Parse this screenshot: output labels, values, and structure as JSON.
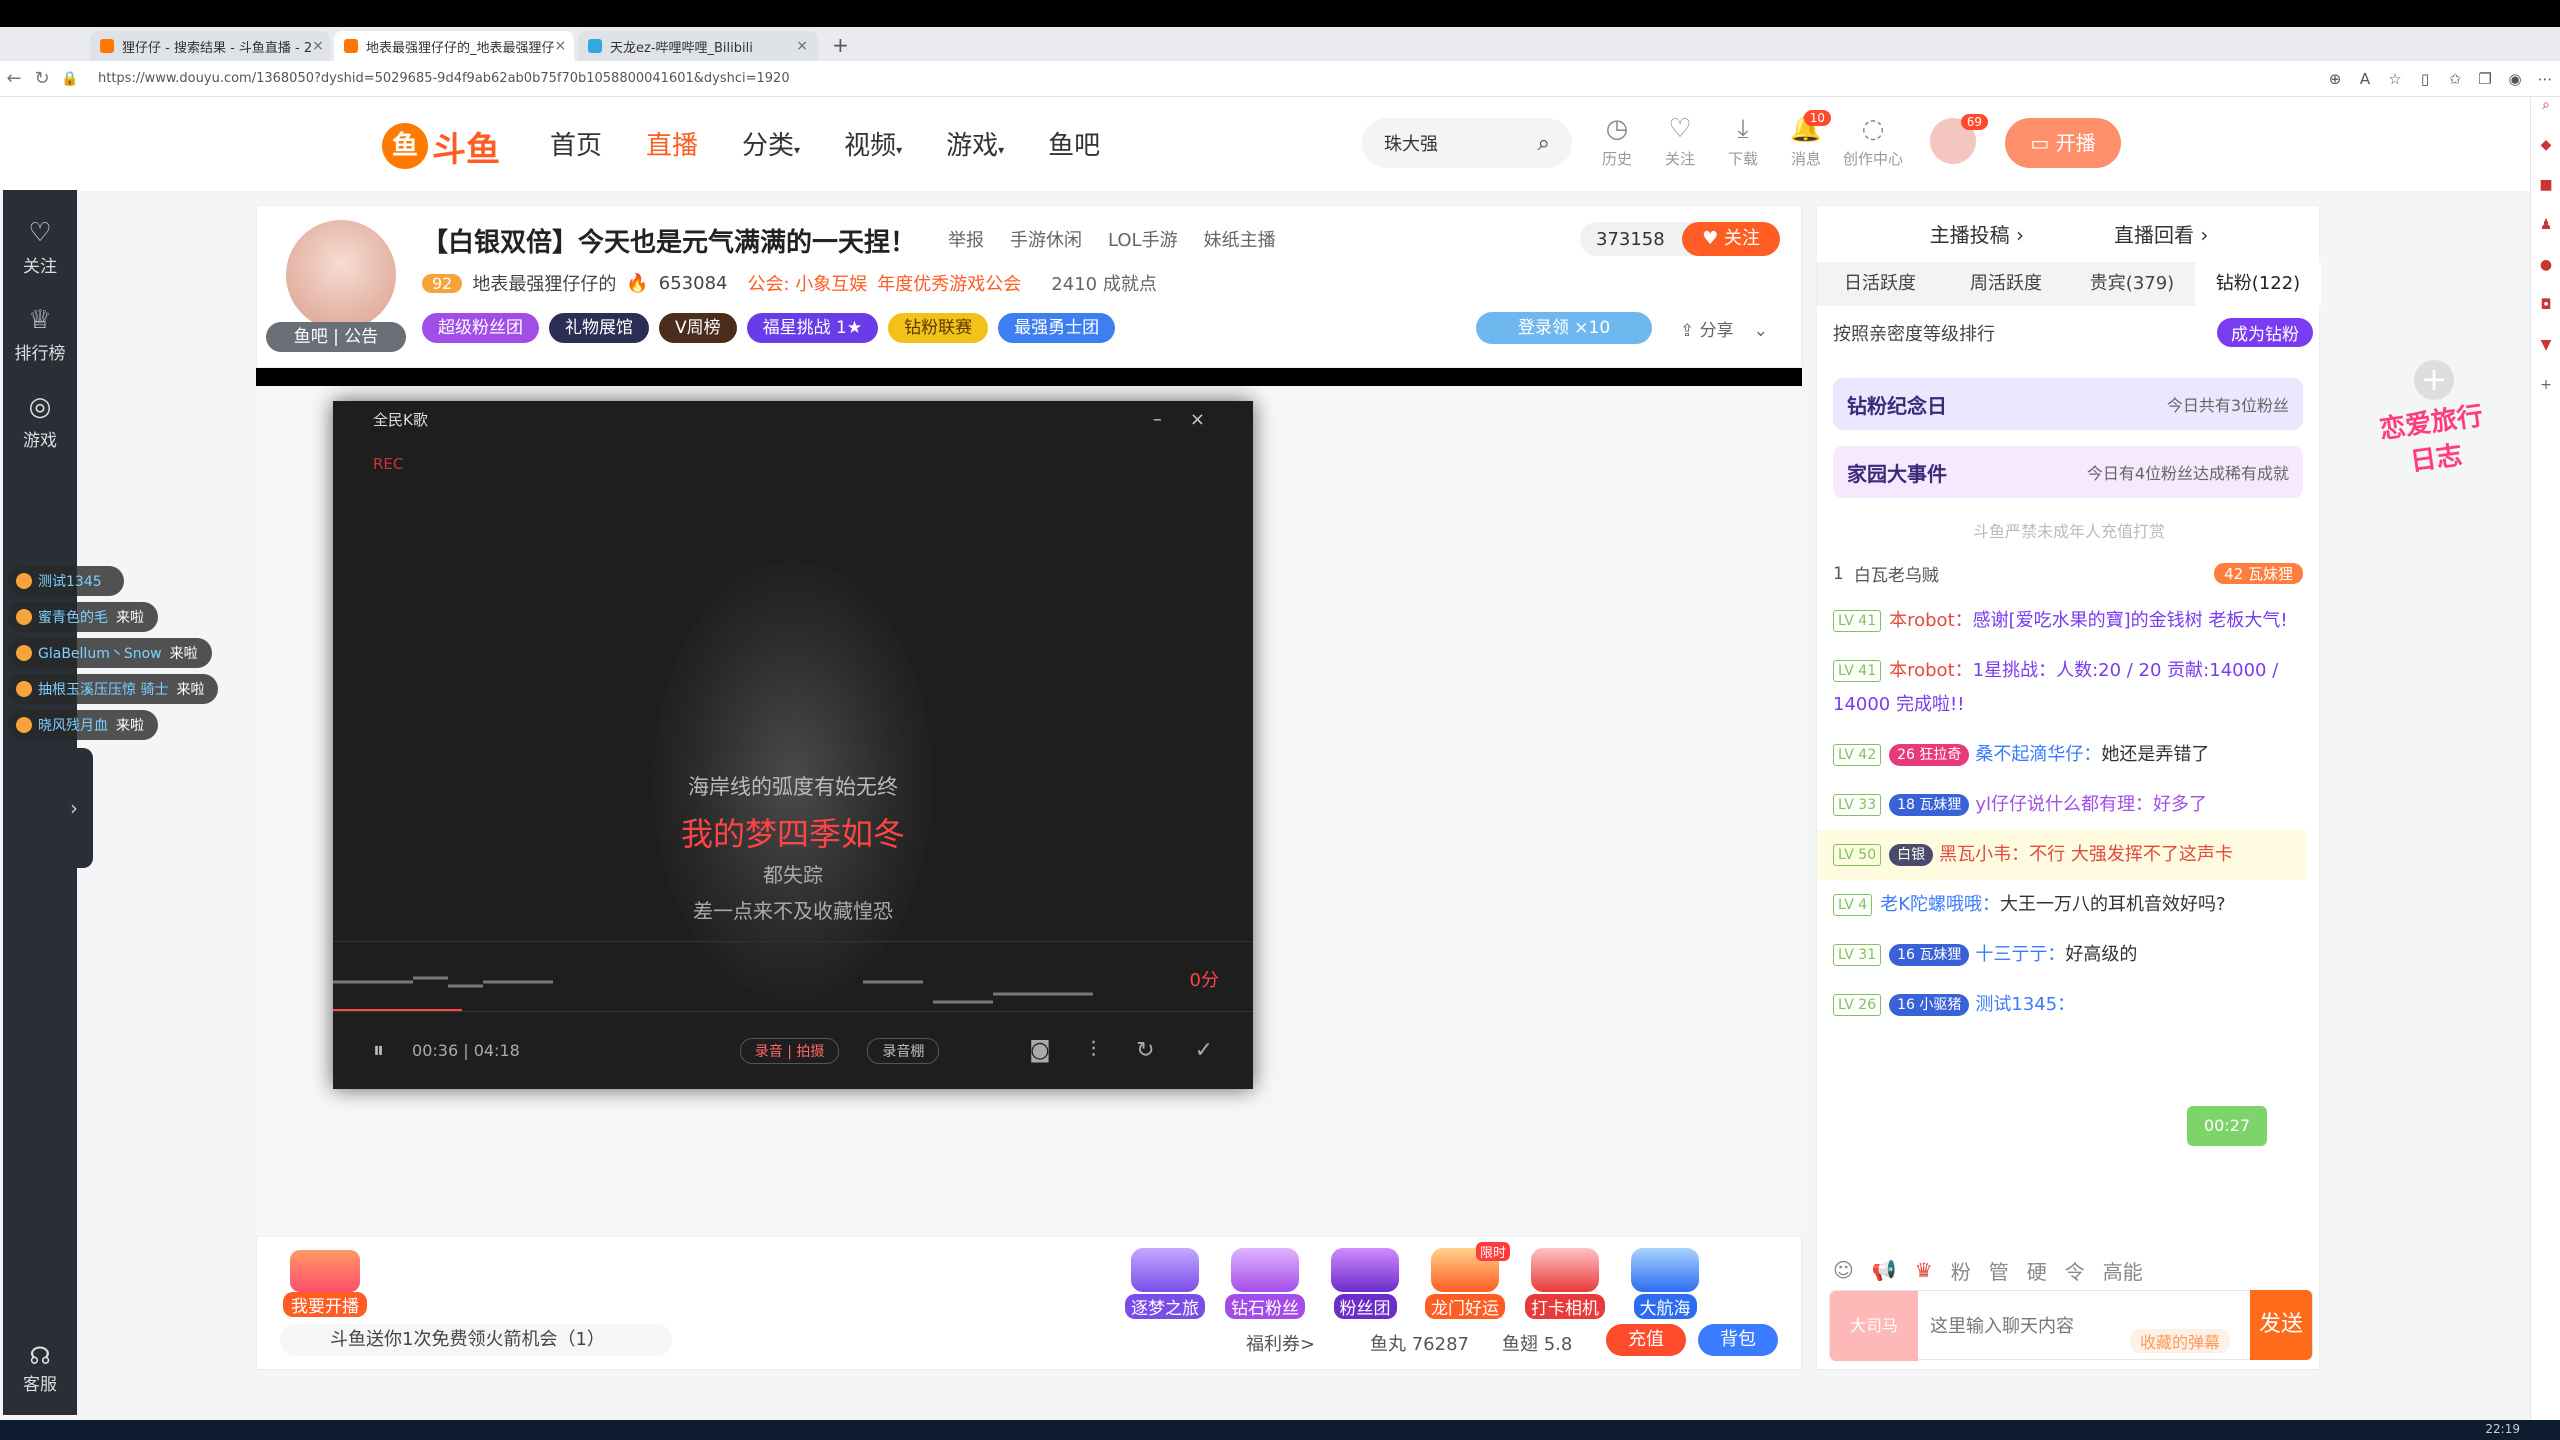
{
  "browser": {
    "tabs": [
      {
        "title": "狸仔仔 - 搜索结果 - 斗鱼直播 - 2"
      },
      {
        "title": "地表最强狸仔仔的_地表最强狸仔"
      },
      {
        "title": "天龙ez-哔哩哔哩_Bilibili"
      }
    ],
    "new_tab": "+",
    "url": "https://www.douyu.com/1368050?dyshid=5029685-9d4f9ab62ab0b75f70b1058800041601&dyshci=1920"
  },
  "site": {
    "logo_text": "斗鱼",
    "nav": [
      "首页",
      "直播",
      "分类",
      "视频",
      "游戏",
      "鱼吧"
    ],
    "search_value": "珠大强",
    "header_icons": [
      {
        "label": "历史",
        "icon": "clock-icon"
      },
      {
        "label": "关注",
        "icon": "heart-icon"
      },
      {
        "label": "下载",
        "icon": "download-icon"
      },
      {
        "label": "消息",
        "icon": "bell-icon",
        "badge": "10"
      },
      {
        "label": "创作中心",
        "icon": "lightbulb-icon"
      }
    ],
    "avatar_badge": "69",
    "live_button": "开播"
  },
  "left_sidebar": {
    "items": [
      {
        "label": "关注",
        "icon": "heart-outline-icon"
      },
      {
        "label": "排行榜",
        "icon": "ranking-icon"
      },
      {
        "label": "游戏",
        "icon": "game-icon"
      }
    ],
    "footer": "客服",
    "expand": "›"
  },
  "welcomes": [
    {
      "name": "测试1345",
      "suffix": ""
    },
    {
      "name": "蜜青色的毛",
      "suffix": "来啦"
    },
    {
      "name": "GlaBellum丶Snow",
      "suffix": "来啦"
    },
    {
      "name": "抽根玉溪压压惊 骑士",
      "suffix": "来啦"
    },
    {
      "name": "晓风残月血",
      "suffix": "来啦"
    }
  ],
  "room": {
    "title": "【白银双倍】今天也是元气满满的一天捏！",
    "report": "举报",
    "categories": [
      "手游休闲",
      "LOL手游",
      "妹纸主播"
    ],
    "host_level": "92",
    "host_name": "地表最强狸仔仔的",
    "heat": "653084",
    "guild": "公会: 小象互娱",
    "guild_award": "年度优秀游戏公会",
    "achievements": "2410 成就点",
    "avatar_tags": "鱼吧 | 公告",
    "pills": [
      "超级粉丝团",
      "礼物展馆",
      "V周榜",
      "福星挑战 1★",
      "钻粉联赛",
      "最强勇士团"
    ],
    "fans_count": "373158",
    "follow": "关注",
    "login_reward": "登录领 ×10",
    "share": "分享"
  },
  "ktv": {
    "title": "全民K歌",
    "rec": "REC",
    "lyrics": [
      "海岸线的弧度有始无终",
      "我的梦四季如冬",
      "都失踪",
      "差一点来不及收藏惶恐"
    ],
    "score": "0分",
    "time": "00:36 | 04:18",
    "record_label": "录音 | 拍摄",
    "mode_label": "录音棚",
    "progress": 0.14
  },
  "giftbar": {
    "start_live": "我要开播",
    "gifts": [
      "逐梦之旅",
      "钻石粉丝",
      "粉丝团",
      "龙门好运",
      "打卡相机",
      "大航海"
    ],
    "limited": "限时",
    "free_msg": "斗鱼送你1次免费领火箭机会（1）",
    "welfare": "福利券>",
    "fishball": "鱼丸 76287",
    "fishwing": "鱼翅 5.8",
    "recharge": "充值",
    "bag": "背包"
  },
  "chat": {
    "top": [
      "主播投稿 ›",
      "直播回看 ›"
    ],
    "tabs": [
      "日活跃度",
      "周活跃度",
      "贵宾(379)",
      "钻粉(122)"
    ],
    "rank_label": "按照亲密度等级排行",
    "become_diamond": "成为钻粉",
    "banner1": {
      "title": "钻粉纪念日",
      "sub": "今日共有3位粉丝"
    },
    "banner2": {
      "title": "家园大事件",
      "sub": "今日有4位粉丝达成稀有成就"
    },
    "notice": "斗鱼严禁未成年人充值打赏",
    "top_rank": {
      "rank": "1",
      "name": "白瓦老乌贼",
      "tag": "42 瓦妹狸"
    },
    "messages": [
      {
        "lv": "LV 41",
        "user": "本robot：",
        "text": "感谢[爱吃水果的寶]的金钱树 老板大气!",
        "hl": false,
        "badge": ""
      },
      {
        "lv": "LV 41",
        "user": "本robot：",
        "text": "1星挑战：人数:20 / 20 贡献:14000 / 14000 完成啦!!",
        "hl": false,
        "badge": ""
      },
      {
        "lv": "LV 42",
        "user": "桑不起滴华仔：",
        "text": "她还是弄错了",
        "hl": false,
        "badge": "26 狂拉奇"
      },
      {
        "lv": "LV 33",
        "user": "yl仔仔说什么都有理：",
        "text": "好多了",
        "hl": false,
        "badge": "18 瓦妹狸"
      },
      {
        "lv": "LV 50",
        "user": "黑瓦小韦：",
        "text": "不行 大强发挥不了这声卡",
        "hl": true,
        "badge": "白银"
      },
      {
        "lv": "LV 4",
        "user": "老K陀螺哦哦：",
        "text": "大王一万八的耳机音效好吗?",
        "hl": false,
        "badge": ""
      },
      {
        "lv": "LV 31",
        "user": "十三亍亍：",
        "text": "好高级的",
        "hl": false,
        "badge": "16 瓦妹狸"
      },
      {
        "lv": "LV 26",
        "user": "测试1345：",
        "text": "",
        "hl": false,
        "badge": "16 小驱猪"
      }
    ],
    "chest_timer": "00:27",
    "tools": [
      "☺",
      "📢",
      "♛",
      "粉",
      "管",
      "硬",
      "令",
      "高能"
    ],
    "input_placeholder": "这里输入聊天内容",
    "barrage_hint": "收藏的弹幕",
    "send": "发送",
    "avatar_label": "大司马"
  },
  "float_badge": "恋爱旅行日志",
  "clock": "22:19"
}
